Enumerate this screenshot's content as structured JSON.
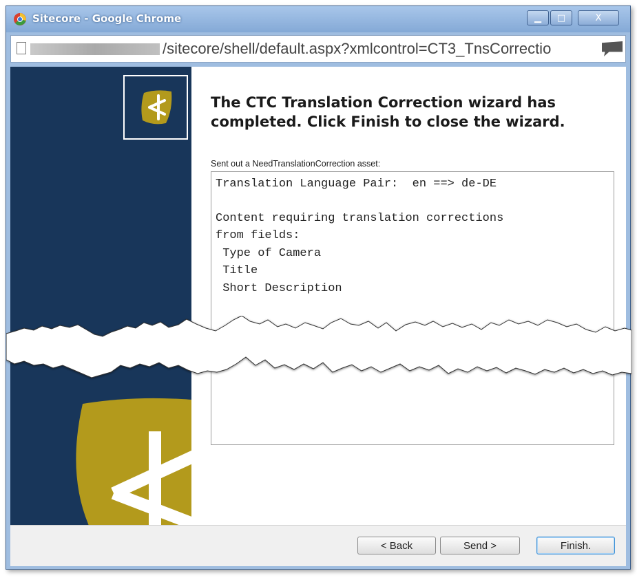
{
  "window": {
    "title": "Sitecore - Google Chrome",
    "minimize_glyph": "▁",
    "maximize_glyph": "□",
    "close_glyph": "X"
  },
  "address_bar": {
    "url_visible": "/sitecore/shell/default.aspx?xmlcontrol=CT3_TnsCorrectio"
  },
  "wizard": {
    "heading": "The CTC Translation Correction wizard has completed. Click Finish to close the wizard.",
    "sent_label": "Sent out a NeedTranslationCorrection asset:",
    "details_lines": [
      "Translation Language Pair:  en ==> de-DE",
      "",
      "Content requiring translation corrections",
      "from fields:",
      " Type of Camera",
      " Title",
      " Short Description"
    ]
  },
  "buttons": {
    "back": "< Back",
    "send": "Send >",
    "finish": "Finish."
  },
  "colors": {
    "sidebar": "#18365a",
    "logo_gold": "#b39a1c",
    "titlebar": "#9fbde0"
  },
  "icons": {
    "chrome": "chrome-icon",
    "page": "page-icon",
    "extension": "puzzle-icon",
    "logo": "sitecore-ctc-logo"
  }
}
